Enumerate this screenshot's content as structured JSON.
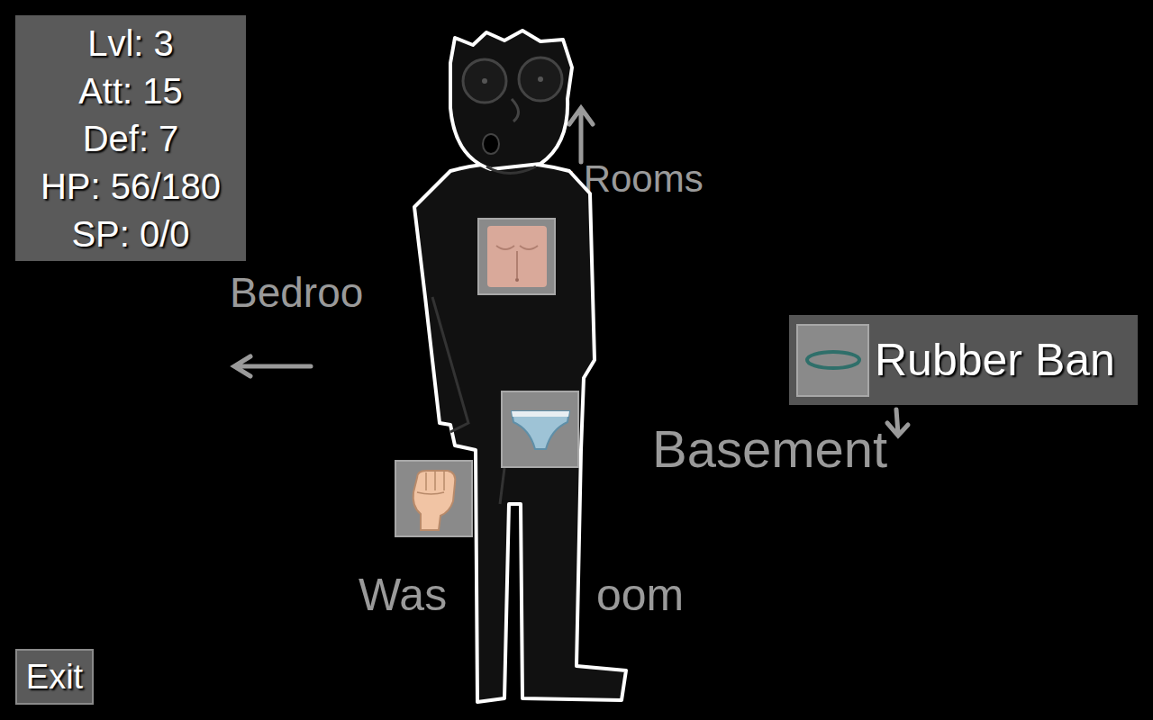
{
  "stats": [
    "Lvl: 3",
    "Att: 15",
    "Def: 7",
    "HP: 56/180",
    "SP: 0/0"
  ],
  "map_labels": [
    {
      "text": "Bedroo",
      "place": "bedroom"
    },
    {
      "text": "r Rooms",
      "place": "other-rooms"
    },
    {
      "text": "Basement",
      "place": "basement"
    },
    {
      "text": "Was",
      "place": "washroom-left"
    },
    {
      "text": "oom",
      "place": "washroom-right"
    }
  ],
  "item": {
    "name": "Rubber Ban"
  },
  "buttons": [
    "Exit"
  ]
}
